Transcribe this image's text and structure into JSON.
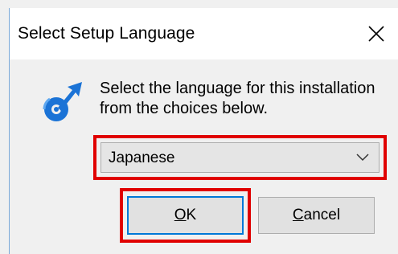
{
  "window": {
    "title": "Select Setup Language"
  },
  "dialog": {
    "prompt": "Select the language for this installation from the choices below.",
    "language_select": {
      "selected": "Japanese"
    },
    "buttons": {
      "ok": {
        "accel": "O",
        "rest": "K"
      },
      "cancel": {
        "accel": "C",
        "rest": "ancel"
      }
    }
  },
  "colors": {
    "highlight": "#e00000",
    "focus_border": "#0078d7",
    "icon_blue": "#1b73d6"
  },
  "icons": {
    "close": "close-icon",
    "setup": "setup-arrow-icon",
    "dropdown": "chevron-down-icon"
  }
}
